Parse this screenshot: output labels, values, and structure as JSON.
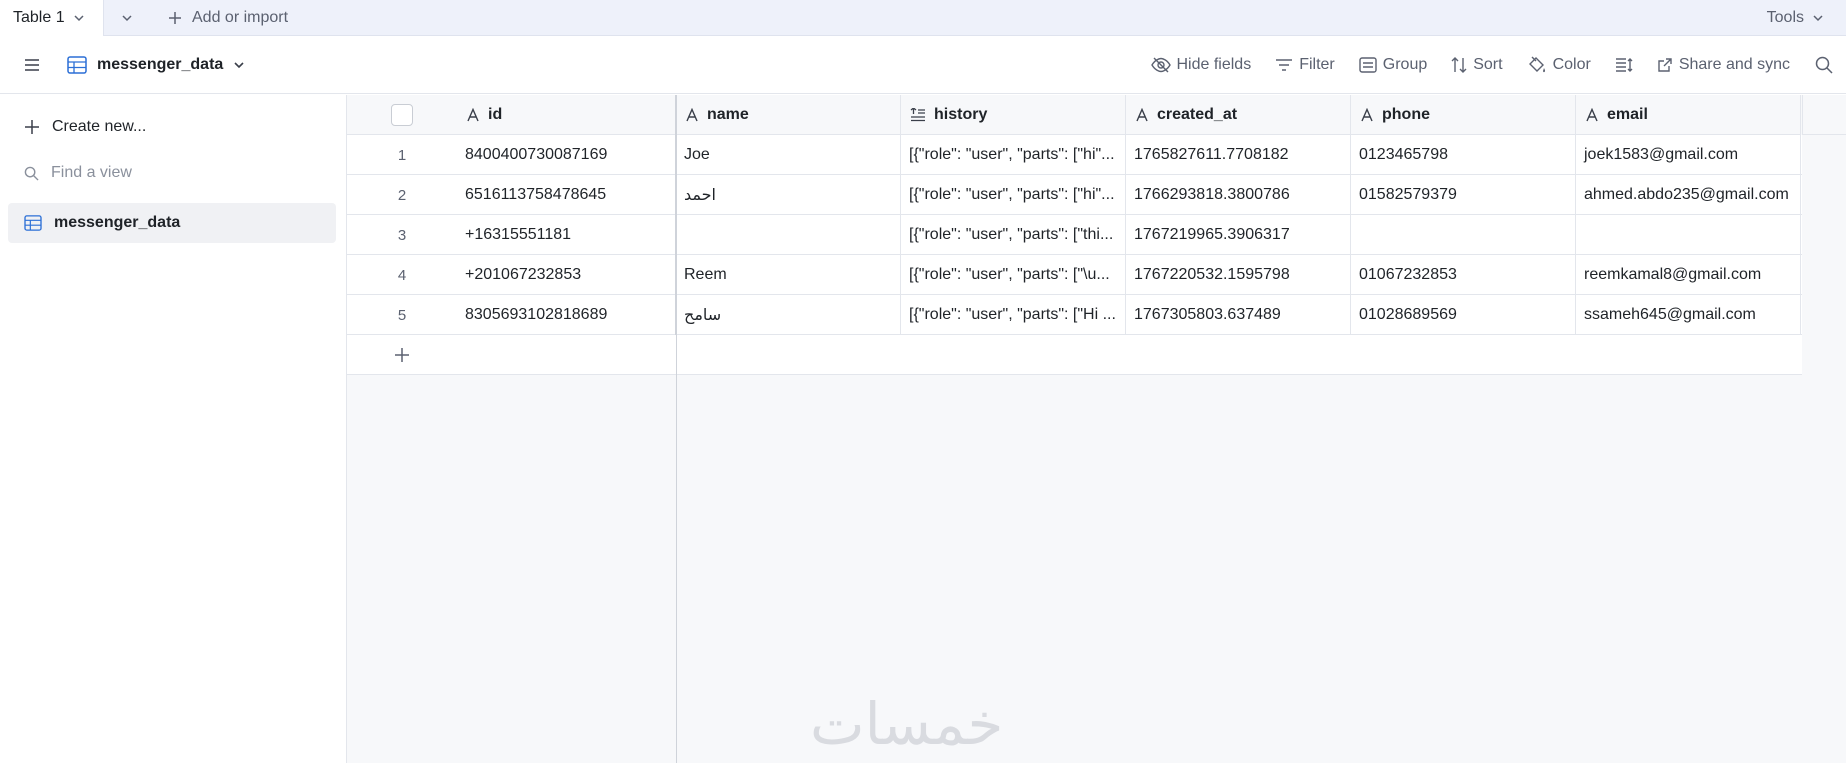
{
  "tabs": {
    "active_tab": "Table 1",
    "add_import_label": "Add or import",
    "tools_label": "Tools"
  },
  "toolbar": {
    "view_name": "messenger_data",
    "hide_fields": "Hide fields",
    "filter": "Filter",
    "group": "Group",
    "sort": "Sort",
    "color": "Color",
    "share_sync": "Share and sync"
  },
  "sidebar": {
    "create_new": "Create new...",
    "find_view": "Find a view",
    "views": [
      {
        "label": "messenger_data"
      }
    ]
  },
  "table": {
    "columns": [
      {
        "label": "id",
        "icon": "text-field-icon"
      },
      {
        "label": "name",
        "icon": "text-field-icon"
      },
      {
        "label": "history",
        "icon": "long-text-icon"
      },
      {
        "label": "created_at",
        "icon": "text-field-icon"
      },
      {
        "label": "phone",
        "icon": "text-field-icon"
      },
      {
        "label": "email",
        "icon": "text-field-icon"
      }
    ],
    "rows": [
      {
        "num": "1",
        "id": "8400400730087169",
        "name": "Joe",
        "history": "[{\"role\": \"user\", \"parts\": [\"hi\"...",
        "created_at": "1765827611.7708182",
        "phone": "0123465798",
        "email": "joek1583@gmail.com"
      },
      {
        "num": "2",
        "id": "6516113758478645",
        "name": "احمد",
        "history": "[{\"role\": \"user\", \"parts\": [\"hi\"...",
        "created_at": "1766293818.3800786",
        "phone": "01582579379",
        "email": "ahmed.abdo235@gmail.com"
      },
      {
        "num": "3",
        "id": "+16315551181",
        "name": "",
        "history": "[{\"role\": \"user\", \"parts\": [\"thi...",
        "created_at": "1767219965.3906317",
        "phone": "",
        "email": ""
      },
      {
        "num": "4",
        "id": "+201067232853",
        "name": "Reem",
        "history": "[{\"role\": \"user\", \"parts\": [\"\\u...",
        "created_at": "1767220532.1595798",
        "phone": "01067232853",
        "email": "reemkamal8@gmail.com"
      },
      {
        "num": "5",
        "id": "8305693102818689",
        "name": "سامح",
        "history": "[{\"role\": \"user\", \"parts\": [\"Hi ...",
        "created_at": "1767305803.637489",
        "phone": "01028689569",
        "email": "ssameh645@gmail.com"
      }
    ]
  },
  "watermark": "خمسات",
  "colors": {
    "accent": "#2b6fd6",
    "tab_strip": "#eef1fa",
    "grid_bg": "#f7f8fa",
    "border": "#e3e6ec"
  }
}
